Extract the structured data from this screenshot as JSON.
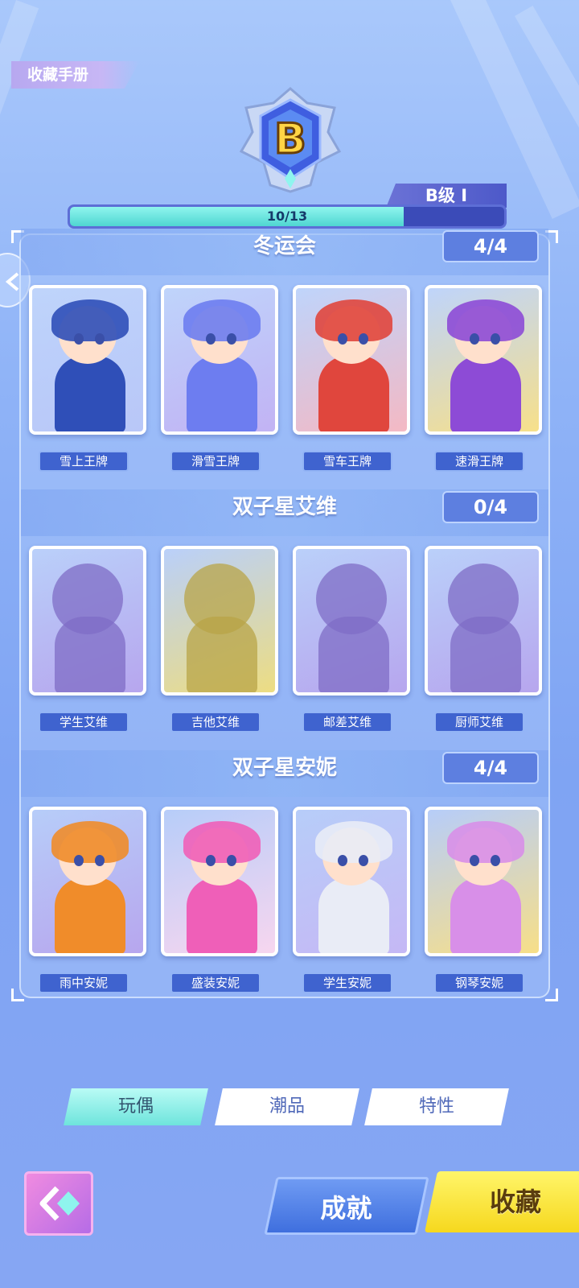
{
  "page": {
    "title": "收藏手册"
  },
  "rank": {
    "badge_letter": "B",
    "label": "B级 I",
    "progress_text": "10/13",
    "progress_fraction": 0.7692
  },
  "sections": [
    {
      "title": "冬运会",
      "count": "4/4",
      "cards": [
        {
          "name": "雪上王牌",
          "owned": true,
          "bg": "#b9c7f8",
          "accent": "#2f4fb8"
        },
        {
          "name": "滑雪王牌",
          "owned": true,
          "bg": "#c2b3f4",
          "accent": "#6d7df0"
        },
        {
          "name": "雪车王牌",
          "owned": true,
          "bg": "#f4b9c4",
          "accent": "#e0463d"
        },
        {
          "name": "速滑王牌",
          "owned": true,
          "bg": "#f7e08a",
          "accent": "#8d4bd6"
        }
      ]
    },
    {
      "title": "双子星艾维",
      "count": "0/4",
      "cards": [
        {
          "name": "学生艾维",
          "owned": false,
          "bg": "#b7a6ee",
          "accent": "#7f6cc6"
        },
        {
          "name": "吉他艾维",
          "owned": false,
          "bg": "#eddd82",
          "accent": "#b8a447"
        },
        {
          "name": "邮差艾维",
          "owned": false,
          "bg": "#b7a6ee",
          "accent": "#7f6cc6"
        },
        {
          "name": "厨师艾维",
          "owned": false,
          "bg": "#b7a6ee",
          "accent": "#7f6cc6"
        }
      ]
    },
    {
      "title": "双子星安妮",
      "count": "4/4",
      "cards": [
        {
          "name": "雨中安妮",
          "owned": true,
          "bg": "#b7a6ee",
          "accent": "#f08c2a"
        },
        {
          "name": "盛装安妮",
          "owned": true,
          "bg": "#f7d6ef",
          "accent": "#ef5fb8"
        },
        {
          "name": "学生安妮",
          "owned": true,
          "bg": "#c5b8f5",
          "accent": "#e9ecf6"
        },
        {
          "name": "钢琴安妮",
          "owned": true,
          "bg": "#f7df88",
          "accent": "#d88fe8"
        }
      ]
    }
  ],
  "tabs": [
    {
      "label": "玩偶",
      "active": true
    },
    {
      "label": "潮品",
      "active": false
    },
    {
      "label": "特性",
      "active": false
    }
  ],
  "bottom": {
    "achieve_label": "成就",
    "collect_label": "收藏"
  },
  "colors": {
    "progress_fill": "#5fdcd6",
    "panel_border": "#dcebff",
    "collect_button": "#f6d81e"
  },
  "icons": {
    "back": "double-chevron-left-icon",
    "side": "chevron-left-icon",
    "badge": "rank-badge-icon"
  }
}
